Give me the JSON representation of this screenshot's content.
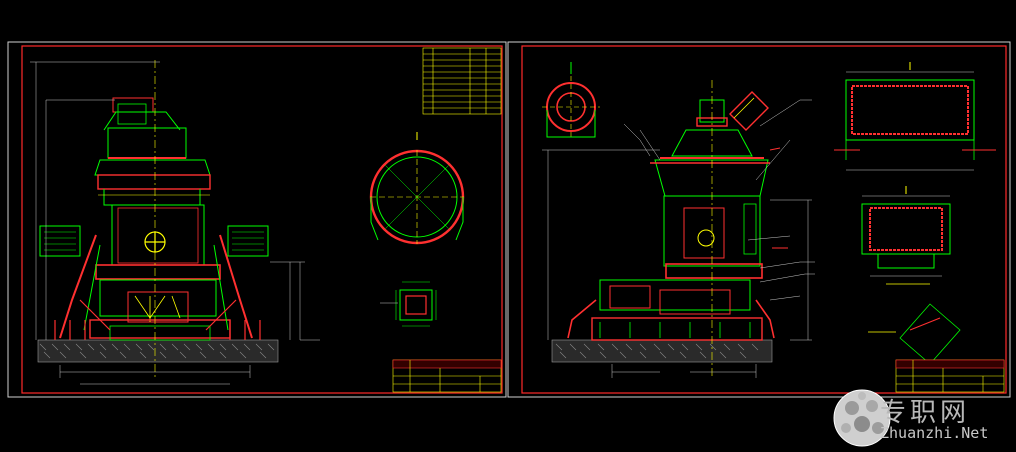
{
  "watermark": {
    "chinese": "专职网",
    "url": "Zhuanzhi.Net"
  },
  "colors": {
    "background": "#000000",
    "frame": "#ff2a2a",
    "line": "#00ff00",
    "detail": "#ff3030",
    "accent": "#ffff00",
    "dimension": "#c8c8c8"
  }
}
